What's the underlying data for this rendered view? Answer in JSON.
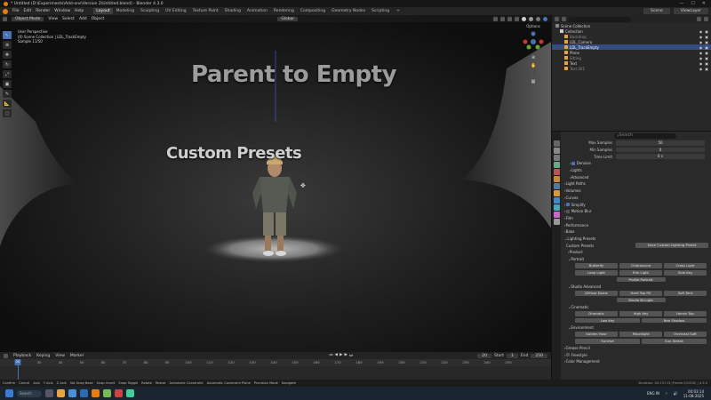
{
  "window": {
    "title": "* Untitled (D:\\Experiments\\Add-ons\\Version 2\\Untitled.blend) - Blender 4.3.0"
  },
  "menubar": {
    "menus": [
      "File",
      "Edit",
      "Render",
      "Window",
      "Help"
    ],
    "workspaces": [
      "Layout",
      "Modeling",
      "Sculpting",
      "UV Editing",
      "Texture Paint",
      "Shading",
      "Animation",
      "Rendering",
      "Compositing",
      "Geometry Nodes",
      "Scripting"
    ],
    "active_workspace": "Layout",
    "scene": "Scene",
    "view_layer": "ViewLayer"
  },
  "viewport": {
    "mode": "Object Mode",
    "menus": [
      "View",
      "Select",
      "Add",
      "Object"
    ],
    "transform": "Global",
    "options_label": "Options",
    "info_lines": [
      "User Perspective",
      "(0) Scene Collection | LDL_TrackEmpty",
      "Sample 11/50"
    ],
    "scene_text_1": "Parent to Empty",
    "scene_text_2": "Custom Presets"
  },
  "outliner": {
    "rows": [
      {
        "label": "Scene Collection",
        "indent": 0,
        "selected": false,
        "color": "#d0d0d0"
      },
      {
        "label": "Collection",
        "indent": 1,
        "selected": false,
        "color": "#d0d0d0"
      },
      {
        "label": "Backdrop",
        "indent": 2,
        "selected": false,
        "color": "#8a8a8a"
      },
      {
        "label": "LDL_Camera",
        "indent": 2,
        "selected": false,
        "color": "#d0d0d0"
      },
      {
        "label": "LDL_TrackEmpty",
        "indent": 2,
        "selected": true,
        "color": "#ffffff"
      },
      {
        "label": "Plane",
        "indent": 2,
        "selected": false,
        "color": "#d0d0d0"
      },
      {
        "label": "Sitting",
        "indent": 2,
        "selected": false,
        "color": "#8a8a8a"
      },
      {
        "label": "Text",
        "indent": 2,
        "selected": false,
        "color": "#d0d0d0"
      },
      {
        "label": "Text.001",
        "indent": 2,
        "selected": false,
        "color": "#8a8a8a"
      }
    ]
  },
  "properties": {
    "search_placeholder": "Search",
    "fields": [
      {
        "label": "Max Samples",
        "value": "50"
      },
      {
        "label": "Min Samples",
        "value": "0"
      },
      {
        "label": "Time Limit",
        "value": "0 s"
      }
    ],
    "sections_top": [
      "Denoise",
      "Lights",
      "Advanced",
      "Light Paths",
      "Volumes",
      "Curves",
      "Simplify",
      "Motion Blur",
      "Film",
      "Performance",
      "Bake",
      "Lighting Presets"
    ],
    "custom_presets_label": "Custom Presets",
    "save_label": "Save Custom Lighting Preset",
    "product_label": "Product",
    "portrait_label": "Portrait",
    "portrait_buttons": [
      [
        "Butterfly",
        "Chiaroscuro",
        "Cross Light"
      ],
      [
        "Loop Light",
        "Rim Light",
        "Side Key"
      ]
    ],
    "profile_label": "Profile Portrait",
    "studio_label": "Studio Advanced",
    "studio_buttons": [
      [
        "Diffuse Dome",
        "Hard Top Fill",
        "Soft Tent"
      ]
    ],
    "studio_extra": "Studio Bi-Light",
    "cinematic_label": "Cinematic",
    "cinematic_buttons": [
      [
        "Dramatic",
        "High Key",
        "Horror Top"
      ]
    ],
    "cinematic_row2": [
      "Low Key",
      "Neo Shadow"
    ],
    "environment_label": "Environment",
    "environment_buttons": [
      [
        "Golden Hour",
        "Moonlight",
        "Overcast Soft"
      ]
    ],
    "environment_row2": [
      "Sunrise",
      "Sun Streak"
    ],
    "sections_bottom": [
      "Grease Pencil",
      "Freestyle",
      "Color Management"
    ]
  },
  "timeline": {
    "menus": [
      "Playback",
      "Keying",
      "View",
      "Marker"
    ],
    "current_frame": "20",
    "start_label": "Start",
    "start": "1",
    "end_label": "End",
    "end": "250",
    "ticks": [
      "20",
      "30",
      "40",
      "50",
      "60",
      "70",
      "80",
      "90",
      "100",
      "110",
      "120",
      "130",
      "140",
      "150",
      "160",
      "170",
      "180",
      "190",
      "200",
      "210",
      "220",
      "230",
      "240",
      "250"
    ]
  },
  "statusbar": {
    "items": [
      "Confirm",
      "Cancel",
      "Axis",
      "Y Axis",
      "Z Axis",
      "Set Snap Base",
      "Snap Invert",
      "Snap Toggle",
      "Rotate",
      "Resize",
      "Automatic Constraint",
      "Automatic Constraint Plane",
      "Precision Mode",
      "Navigate"
    ],
    "right": "Duration: 00:13+13 (Frame 0/1000) | 4.3.0"
  },
  "taskbar": {
    "search_label": "Search",
    "time": "00:03:14",
    "date": "11-08-2025",
    "lang": "ENG IN"
  },
  "colors": {
    "accent": "#4772b3",
    "blender_orange": "#e87d0d"
  }
}
